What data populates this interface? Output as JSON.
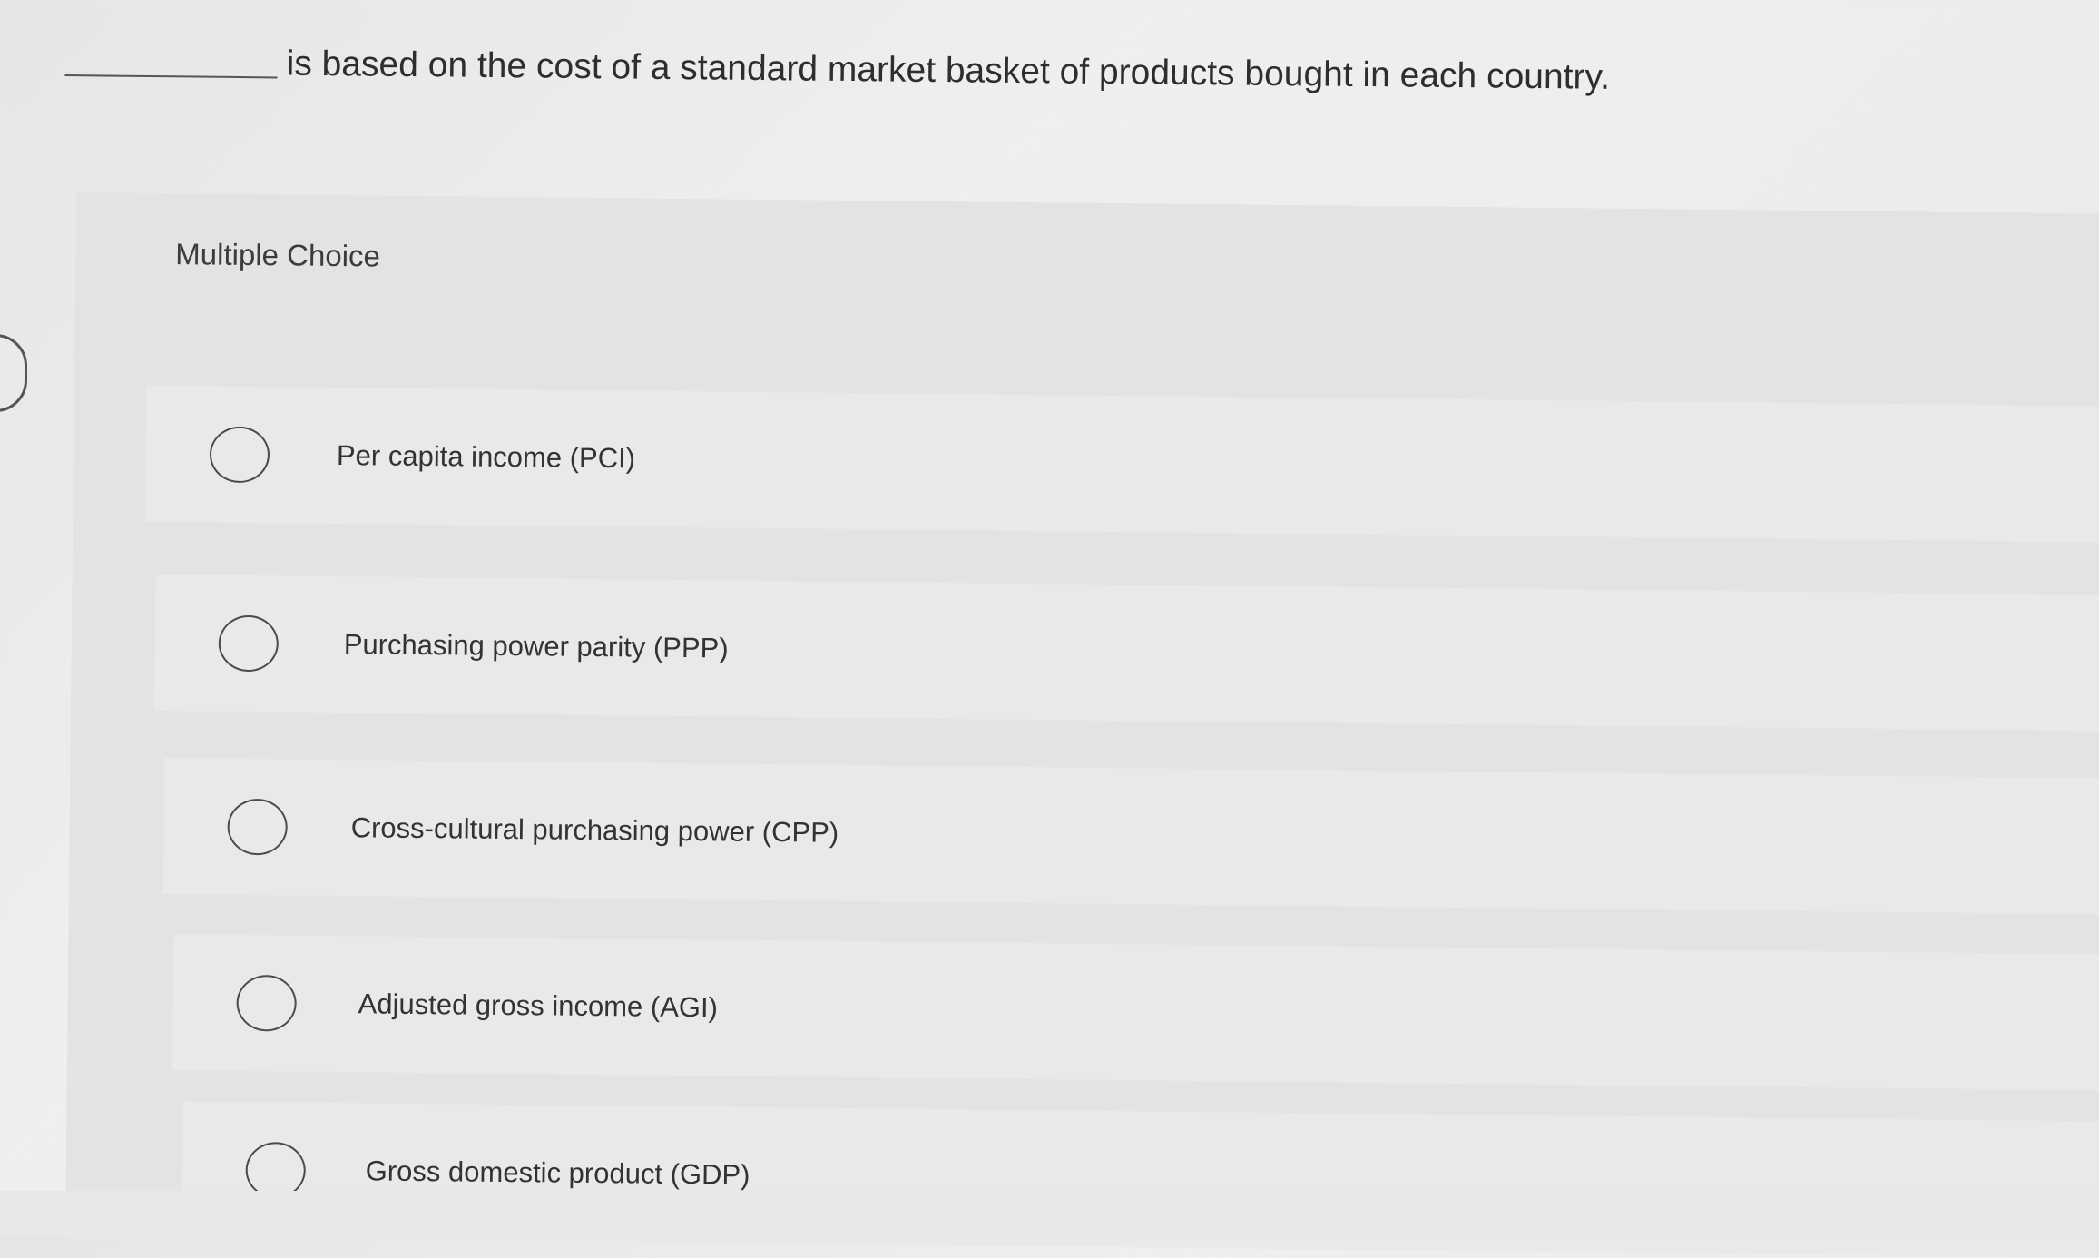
{
  "question": {
    "text": "is based on the cost of a standard market basket of products bought in each country."
  },
  "panel": {
    "title": "Multiple Choice"
  },
  "options": [
    {
      "label": "Per capita income (PCI)"
    },
    {
      "label": "Purchasing power parity (PPP)"
    },
    {
      "label": "Cross-cultural purchasing power (CPP)"
    },
    {
      "label": "Adjusted gross income (AGI)"
    },
    {
      "label": "Gross domestic product (GDP)"
    }
  ]
}
